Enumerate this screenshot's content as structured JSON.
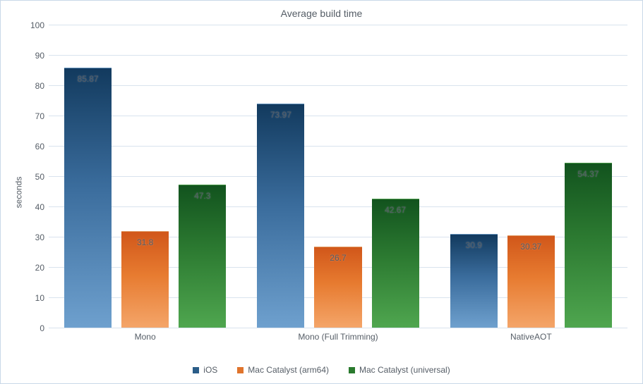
{
  "chart_data": {
    "type": "bar",
    "title": "Average build time",
    "ylabel": "seconds",
    "xlabel": "",
    "ylim": [
      0,
      100
    ],
    "yticks": [
      0,
      10,
      20,
      30,
      40,
      50,
      60,
      70,
      80,
      90,
      100
    ],
    "categories": [
      "Mono",
      "Mono (Full Trimming)",
      "NativeAOT"
    ],
    "series": [
      {
        "name": "iOS",
        "values": [
          85.87,
          73.97,
          30.9
        ],
        "color": "#2b5d88"
      },
      {
        "name": "Mac Catalyst (arm64)",
        "values": [
          31.8,
          26.7,
          30.37
        ],
        "color": "#e0742c"
      },
      {
        "name": "Mac Catalyst (universal)",
        "values": [
          47.3,
          42.67,
          54.37
        ],
        "color": "#2a7a2e"
      }
    ],
    "legend_position": "bottom",
    "grid": true
  }
}
